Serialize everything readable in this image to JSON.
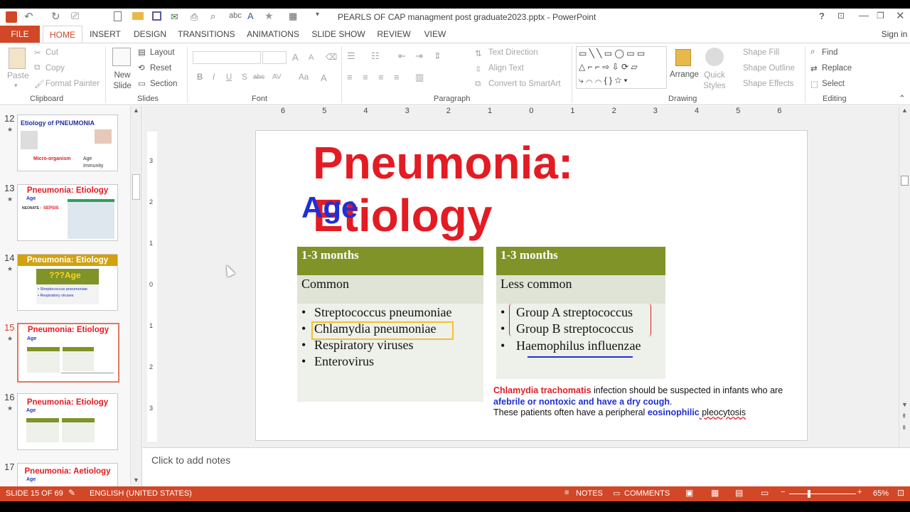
{
  "window": {
    "title": "PEARLS OF CAP  managment post graduate2023.pptx - PowerPoint",
    "help": "?",
    "signin": "Sign in"
  },
  "tabs": [
    "FILE",
    "HOME",
    "INSERT",
    "DESIGN",
    "TRANSITIONS",
    "ANIMATIONS",
    "SLIDE SHOW",
    "REVIEW",
    "VIEW"
  ],
  "ribbon": {
    "clipboard": {
      "paste": "Paste",
      "cut": "Cut",
      "copy": "Copy",
      "format_painter": "Format Painter",
      "label": "Clipboard"
    },
    "slides": {
      "new_slide": "New Slide",
      "layout": "Layout",
      "reset": "Reset",
      "section": "Section",
      "label": "Slides"
    },
    "font": {
      "label": "Font",
      "bold": "B",
      "italic": "I",
      "underline": "U",
      "shadow": "S",
      "strike": "abc",
      "spacing": "AV",
      "case": "Aa",
      "grow": "A",
      "shrink": "A"
    },
    "paragraph": {
      "text_direction": "Text Direction",
      "align_text": "Align Text",
      "convert": "Convert to SmartArt",
      "label": "Paragraph"
    },
    "drawing": {
      "arrange": "Arrange",
      "quick_styles": "Quick Styles",
      "shape_fill": "Shape Fill",
      "shape_outline": "Shape Outline",
      "shape_effects": "Shape Effects",
      "label": "Drawing"
    },
    "editing": {
      "find": "Find",
      "replace": "Replace",
      "select": "Select",
      "label": "Editing"
    }
  },
  "thumbnails": [
    {
      "num": "12",
      "title": "Etiology of PNEUMONIA",
      "t1": "Micro-organism",
      "t2": "Age",
      "t3": "Immunity"
    },
    {
      "num": "13",
      "title": "Pneumonia: Etiology",
      "t1": "Age",
      "t2": "NEONATE :",
      "t3": "SEPSIS"
    },
    {
      "num": "14",
      "title": "Pneumonia: Etiology",
      "t1": "???Age",
      "t2": "• Streptococcus pneumoniae",
      "t3": "• Respiratory viruses"
    },
    {
      "num": "15",
      "title": "Pneumonia: Etiology",
      "t1": "Age"
    },
    {
      "num": "16",
      "title": "Pneumonia: Etiology",
      "t1": "Age"
    },
    {
      "num": "17",
      "title": "Pneumonia: Aetiology",
      "t1": "Age"
    }
  ],
  "ruler": {
    "h": [
      "6",
      "5",
      "4",
      "3",
      "2",
      "1",
      "0",
      "1",
      "2",
      "3",
      "4",
      "5",
      "6"
    ],
    "v": [
      "3",
      "2",
      "1",
      "0",
      "1",
      "2",
      "3"
    ]
  },
  "slide": {
    "title": "Pneumonia: Etiology",
    "subtitle": "Age",
    "left": {
      "header": "1-3 months",
      "sub": "Common",
      "items": [
        "Streptococcus pneumoniae",
        "Chlamydia pneumoniae",
        "Respiratory viruses",
        "Enterovirus"
      ]
    },
    "right": {
      "header": "1-3 months",
      "sub": "Less common",
      "items": [
        "Group A streptococcus",
        "Group B streptococcus",
        "Haemophilus influenzae"
      ]
    },
    "note": {
      "red": "Chlamydia trachomatis",
      "n1": " infection should be suspected in infants who are ",
      "blue1": "afebrile or nontoxic and have a dry cough",
      "n2": ".",
      "n3": "These patients often have a peripheral ",
      "blue2": "eosinophilic",
      "n4": " pleocytosis"
    },
    "colors": {
      "title": "#e31b23",
      "subtitle": "#1f2fd6",
      "header": "#7f9328"
    }
  },
  "notes": {
    "placeholder": "Click to add notes"
  },
  "status": {
    "slide": "SLIDE 15 OF 69",
    "language": "ENGLISH (UNITED STATES)",
    "notes": "NOTES",
    "comments": "COMMENTS",
    "zoom": "65%"
  }
}
